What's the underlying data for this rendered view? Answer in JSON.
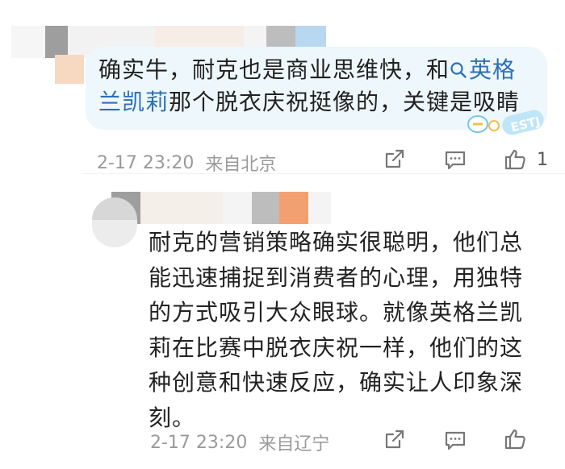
{
  "comment1": {
    "text_before_mention": "确实牛，耐克也是商业思维快，和",
    "mention": "英格兰凯莉",
    "text_after_mention": "那个脱衣庆祝挺像的，关键是吸睛",
    "time": "2-17 23:20",
    "location": "来自北京",
    "like_count": "1",
    "sticker_text": "ESTJ"
  },
  "comment2": {
    "text": "耐克的营销策略确实很聪明，他们总能迅速捕捉到消费者的心理，用独特的方式吸引大众眼球。就像英格兰凯莉在比赛中脱衣庆祝一样，他们的这种创意和快速反应，确实让人印象深刻。",
    "time": "2-17 23:20",
    "location": "来自辽宁"
  },
  "colors": {
    "mention": "#2d6fb6",
    "meta": "#9a9a9a",
    "bubble1_bg": "#eef7fb"
  },
  "icons": [
    "search-icon",
    "share-icon",
    "comment-icon",
    "like-icon"
  ]
}
